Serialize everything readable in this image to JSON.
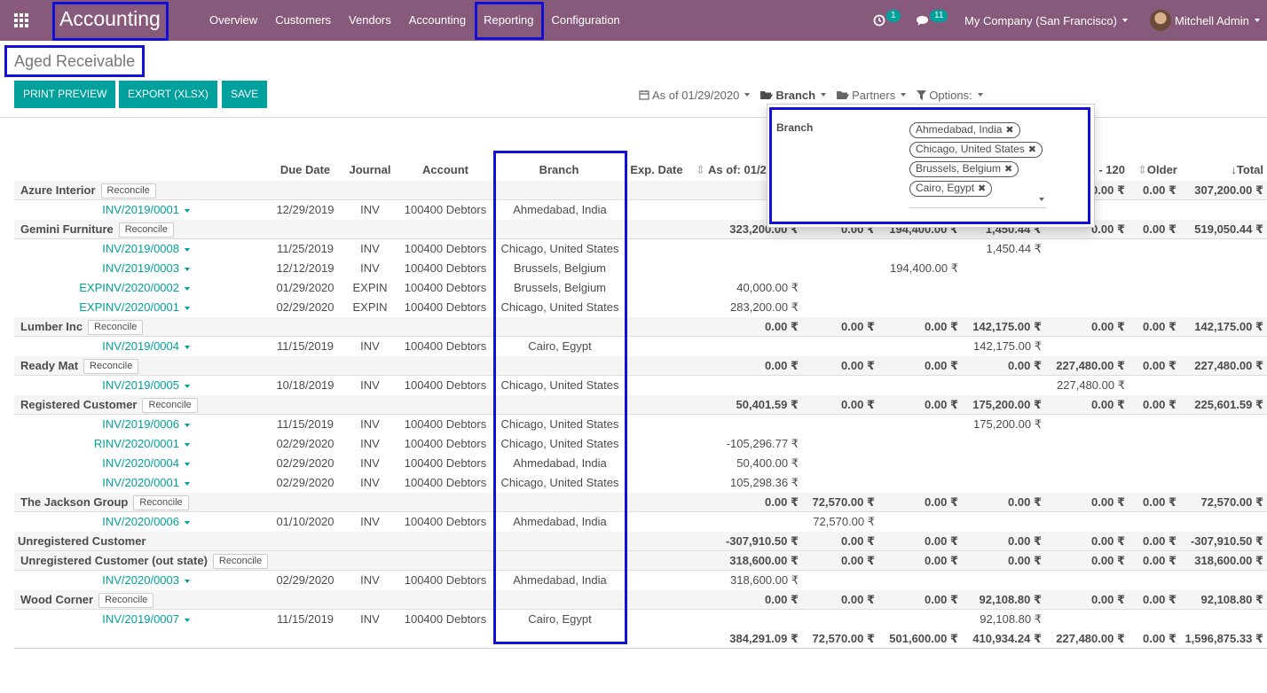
{
  "nav": {
    "brand": "Accounting",
    "menu": [
      "Overview",
      "Customers",
      "Vendors",
      "Accounting",
      "Reporting",
      "Configuration"
    ],
    "activity_count": "1",
    "messages_count": "11",
    "company": "My Company (San Francisco)",
    "user": "Mitchell Admin"
  },
  "page": {
    "title": "Aged Receivable",
    "buttons": {
      "print": "PRINT PREVIEW",
      "export": "EXPORT (XLSX)",
      "save": "SAVE"
    }
  },
  "filters": {
    "date": "As of 01/29/2020",
    "branch": "Branch",
    "partners": "Partners",
    "options": "Options:"
  },
  "branch_dropdown": {
    "label": "Branch",
    "tags": [
      "Ahmedabad, India",
      "Chicago, United States",
      "Brussels, Belgium",
      "Cairo, Egypt"
    ]
  },
  "table": {
    "headers": {
      "due_date": "Due Date",
      "journal": "Journal",
      "account": "Account",
      "branch": "Branch",
      "exp_date": "Exp. Date",
      "as_of": "As of: 01/29",
      "b120": "- 120",
      "older": "Older",
      "total": "Total"
    },
    "reconcile_label": "Reconcile",
    "rows": [
      {
        "type": "partner",
        "name": "Azure Interior",
        "reconcile": true,
        "vals": [
          "",
          "",
          "",
          "",
          "0.00 ₹",
          "0.00 ₹",
          "307,200.00 ₹"
        ]
      },
      {
        "type": "line",
        "ref": "INV/2019/0001",
        "due": "12/29/2019",
        "journal": "INV",
        "account": "100400 Debtors",
        "branch": "Ahmedabad, India",
        "vals": [
          "",
          "",
          "",
          "",
          "",
          "",
          ""
        ]
      },
      {
        "type": "partner",
        "name": "Gemini Furniture",
        "reconcile": true,
        "vals": [
          "323,200.00 ₹",
          "0.00 ₹",
          "194,400.00 ₹",
          "1,450.44 ₹",
          "0.00 ₹",
          "0.00 ₹",
          "519,050.44 ₹"
        ]
      },
      {
        "type": "line",
        "ref": "INV/2019/0008",
        "due": "11/25/2019",
        "journal": "INV",
        "account": "100400 Debtors",
        "branch": "Chicago, United States",
        "vals": [
          "",
          "",
          "",
          "1,450.44 ₹",
          "",
          "",
          ""
        ]
      },
      {
        "type": "line",
        "ref": "INV/2019/0003",
        "due": "12/12/2019",
        "journal": "INV",
        "account": "100400 Debtors",
        "branch": "Brussels, Belgium",
        "vals": [
          "",
          "",
          "194,400.00 ₹",
          "",
          "",
          "",
          ""
        ]
      },
      {
        "type": "line",
        "ref": "EXPINV/2020/0002",
        "due": "01/29/2020",
        "journal": "EXPIN",
        "account": "100400 Debtors",
        "branch": "Brussels, Belgium",
        "vals": [
          "40,000.00 ₹",
          "",
          "",
          "",
          "",
          "",
          ""
        ]
      },
      {
        "type": "line",
        "ref": "EXPINV/2020/0001",
        "due": "02/29/2020",
        "journal": "EXPIN",
        "account": "100400 Debtors",
        "branch": "Chicago, United States",
        "vals": [
          "283,200.00 ₹",
          "",
          "",
          "",
          "",
          "",
          ""
        ]
      },
      {
        "type": "partner",
        "name": "Lumber Inc",
        "reconcile": true,
        "vals": [
          "0.00 ₹",
          "0.00 ₹",
          "0.00 ₹",
          "142,175.00 ₹",
          "0.00 ₹",
          "0.00 ₹",
          "142,175.00 ₹"
        ]
      },
      {
        "type": "line",
        "ref": "INV/2019/0004",
        "due": "11/15/2019",
        "journal": "INV",
        "account": "100400 Debtors",
        "branch": "Cairo, Egypt",
        "vals": [
          "",
          "",
          "",
          "142,175.00 ₹",
          "",
          "",
          ""
        ]
      },
      {
        "type": "partner",
        "name": "Ready Mat",
        "reconcile": true,
        "vals": [
          "0.00 ₹",
          "0.00 ₹",
          "0.00 ₹",
          "0.00 ₹",
          "227,480.00 ₹",
          "0.00 ₹",
          "227,480.00 ₹"
        ]
      },
      {
        "type": "line",
        "ref": "INV/2019/0005",
        "due": "10/18/2019",
        "journal": "INV",
        "account": "100400 Debtors",
        "branch": "Chicago, United States",
        "vals": [
          "",
          "",
          "",
          "",
          "227,480.00 ₹",
          "",
          ""
        ]
      },
      {
        "type": "partner",
        "name": "Registered Customer",
        "reconcile": true,
        "vals": [
          "50,401.59 ₹",
          "0.00 ₹",
          "0.00 ₹",
          "175,200.00 ₹",
          "0.00 ₹",
          "0.00 ₹",
          "225,601.59 ₹"
        ]
      },
      {
        "type": "line",
        "ref": "INV/2019/0006",
        "due": "11/15/2019",
        "journal": "INV",
        "account": "100400 Debtors",
        "branch": "Chicago, United States",
        "vals": [
          "",
          "",
          "",
          "175,200.00 ₹",
          "",
          "",
          ""
        ]
      },
      {
        "type": "line",
        "ref": "RINV/2020/0001",
        "due": "02/29/2020",
        "journal": "INV",
        "account": "100400 Debtors",
        "branch": "Chicago, United States",
        "vals": [
          "-105,296.77 ₹",
          "",
          "",
          "",
          "",
          "",
          ""
        ]
      },
      {
        "type": "line",
        "ref": "INV/2020/0004",
        "due": "02/29/2020",
        "journal": "INV",
        "account": "100400 Debtors",
        "branch": "Ahmedabad, India",
        "vals": [
          "50,400.00 ₹",
          "",
          "",
          "",
          "",
          "",
          ""
        ]
      },
      {
        "type": "line",
        "ref": "INV/2020/0001",
        "due": "02/29/2020",
        "journal": "INV",
        "account": "100400 Debtors",
        "branch": "Chicago, United States",
        "vals": [
          "105,298.36 ₹",
          "",
          "",
          "",
          "",
          "",
          ""
        ]
      },
      {
        "type": "partner",
        "name": "The Jackson Group",
        "reconcile": true,
        "vals": [
          "0.00 ₹",
          "72,570.00 ₹",
          "0.00 ₹",
          "0.00 ₹",
          "0.00 ₹",
          "0.00 ₹",
          "72,570.00 ₹"
        ]
      },
      {
        "type": "line",
        "ref": "INV/2020/0006",
        "due": "01/10/2020",
        "journal": "INV",
        "account": "100400 Debtors",
        "branch": "Ahmedabad, India",
        "vals": [
          "",
          "72,570.00 ₹",
          "",
          "",
          "",
          "",
          ""
        ]
      },
      {
        "type": "partner",
        "name": "Unregistered Customer",
        "reconcile": false,
        "vals": [
          "-307,910.50 ₹",
          "0.00 ₹",
          "0.00 ₹",
          "0.00 ₹",
          "0.00 ₹",
          "0.00 ₹",
          "-307,910.50 ₹"
        ]
      },
      {
        "type": "partner",
        "name": "Unregistered Customer (out state)",
        "reconcile": true,
        "vals": [
          "318,600.00 ₹",
          "0.00 ₹",
          "0.00 ₹",
          "0.00 ₹",
          "0.00 ₹",
          "0.00 ₹",
          "318,600.00 ₹"
        ]
      },
      {
        "type": "line",
        "ref": "INV/2020/0003",
        "due": "02/29/2020",
        "journal": "INV",
        "account": "100400 Debtors",
        "branch": "Ahmedabad, India",
        "vals": [
          "318,600.00 ₹",
          "",
          "",
          "",
          "",
          "",
          ""
        ]
      },
      {
        "type": "partner",
        "name": "Wood Corner",
        "reconcile": true,
        "vals": [
          "0.00 ₹",
          "0.00 ₹",
          "0.00 ₹",
          "92,108.80 ₹",
          "0.00 ₹",
          "0.00 ₹",
          "92,108.80 ₹"
        ]
      },
      {
        "type": "line",
        "ref": "INV/2019/0007",
        "due": "11/15/2019",
        "journal": "INV",
        "account": "100400 Debtors",
        "branch": "Cairo, Egypt",
        "vals": [
          "",
          "",
          "",
          "92,108.80 ₹",
          "",
          "",
          ""
        ]
      },
      {
        "type": "total",
        "vals": [
          "384,291.09 ₹",
          "72,570.00 ₹",
          "501,600.00 ₹",
          "410,934.24 ₹",
          "227,480.00 ₹",
          "0.00 ₹",
          "1,596,875.33 ₹"
        ]
      }
    ]
  }
}
